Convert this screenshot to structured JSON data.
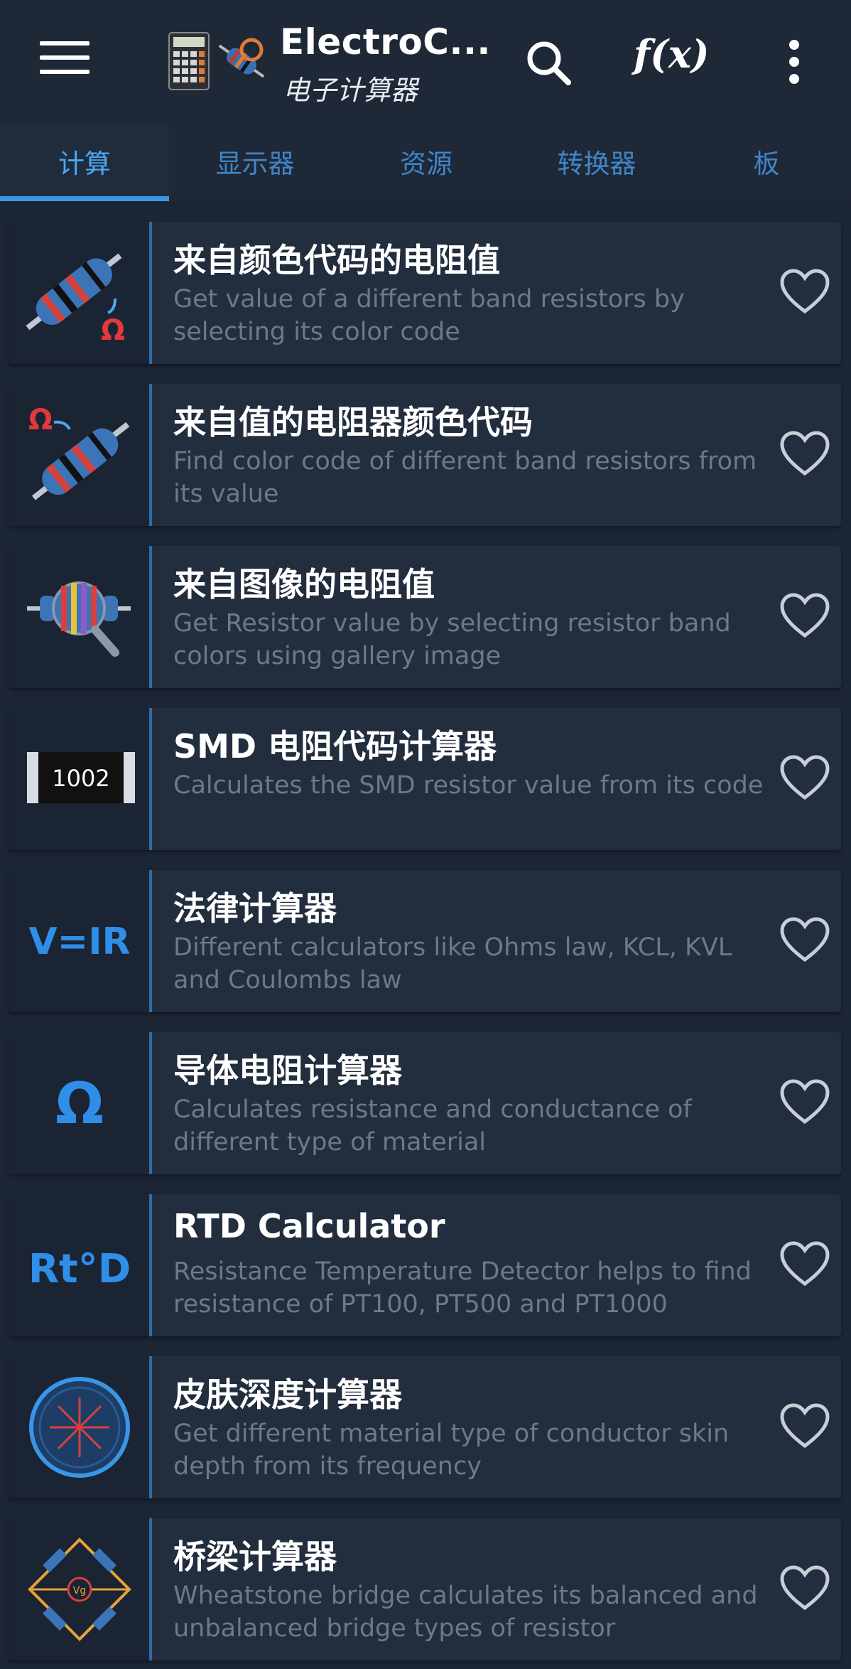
{
  "appbar": {
    "title": "ElectroC...",
    "subtitle": "电子计算器",
    "fx_label": "f(x)",
    "icons": [
      "menu-icon",
      "calculator-logo-icon",
      "search-icon",
      "more-vert-icon"
    ]
  },
  "tabs": [
    {
      "label": "计算",
      "active": true
    },
    {
      "label": "显示器",
      "active": false
    },
    {
      "label": "资源",
      "active": false
    },
    {
      "label": "转换器",
      "active": false
    },
    {
      "label": "板",
      "active": false
    }
  ],
  "items": [
    {
      "title": "来自颜色代码的电阻值",
      "desc": "Get value of a different band resistors by selecting its color code",
      "icon": "resistor-to-ohm-icon"
    },
    {
      "title": "来自值的电阻器颜色代码",
      "desc": "Find color code of different band resistors from its value",
      "icon": "ohm-to-resistor-icon"
    },
    {
      "title": "来自图像的电阻值",
      "desc": "Get Resistor value by selecting resistor band colors using gallery image",
      "icon": "resistor-magnifier-icon"
    },
    {
      "title": "SMD 电阻代码计算器",
      "desc": "Calculates the SMD resistor value from its code",
      "icon": "smd-resistor-icon",
      "icon_text": "1002"
    },
    {
      "title": "法律计算器",
      "desc": "Different calculators like Ohms law, KCL, KVL and Coulombs law",
      "icon": "ohms-law-icon",
      "icon_text": "V=IR"
    },
    {
      "title": "导体电阻计算器",
      "desc": "Calculates resistance and conductance of different type of material",
      "icon": "omega-icon",
      "icon_text": "Ω"
    },
    {
      "title": "RTD Calculator",
      "desc": "Resistance Temperature Detector helps to find resistance of PT100, PT500 and PT1000",
      "icon": "rtd-icon",
      "icon_text": "Rt°D"
    },
    {
      "title": "皮肤深度计算器",
      "desc": "Get different material type of conductor skin depth from its frequency",
      "icon": "skin-depth-icon"
    },
    {
      "title": "桥梁计算器",
      "desc": "Wheatstone bridge calculates its balanced and unbalanced bridge types of resistor",
      "icon": "wheatstone-bridge-icon",
      "icon_text": "Vg"
    }
  ],
  "colors": {
    "background": "#1c2533",
    "card": "#222d3d",
    "accent": "#3b95e6",
    "tab_text": "#3f86c9",
    "desc_text": "#6d7889",
    "heart": "#c9ced6"
  }
}
